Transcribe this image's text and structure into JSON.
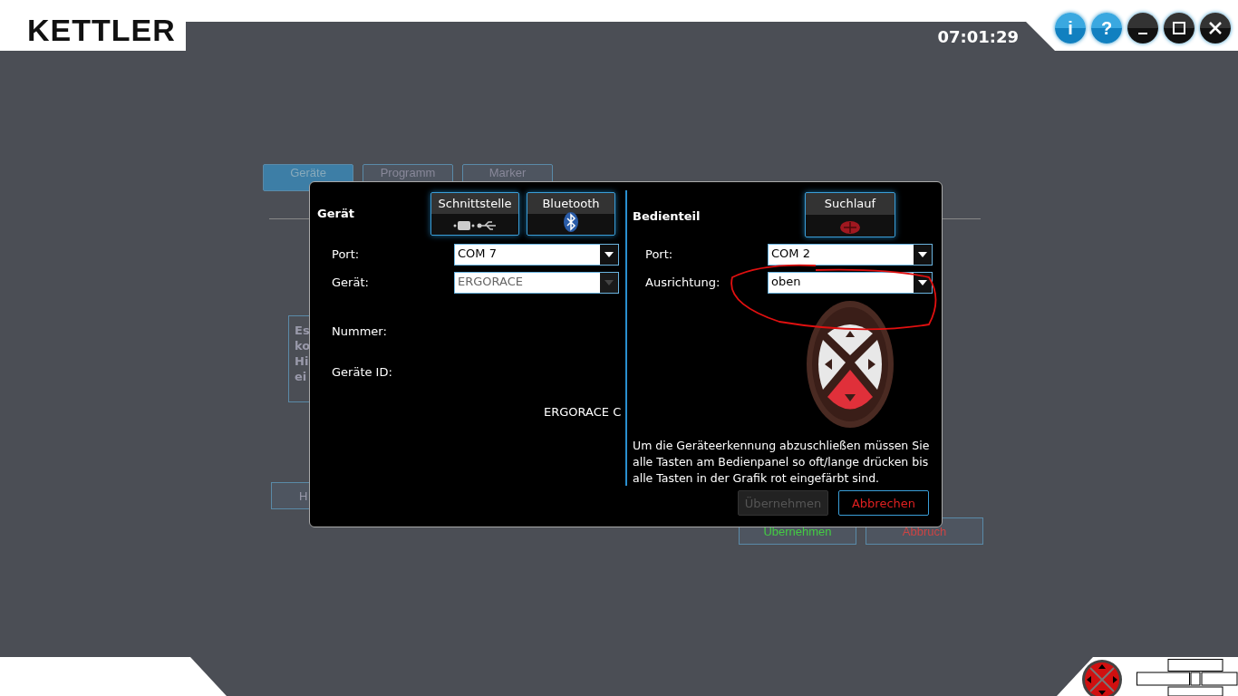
{
  "header": {
    "logo": "KETTLER",
    "clock": "07:01:29",
    "buttons": [
      {
        "kind": "info",
        "label": "i"
      },
      {
        "kind": "help",
        "label": "?"
      },
      {
        "kind": "minimize"
      },
      {
        "kind": "maximize"
      },
      {
        "kind": "close"
      }
    ]
  },
  "background": {
    "tabs": [
      {
        "label": "Geräte",
        "selected": true
      },
      {
        "label": "Programm",
        "selected": false
      },
      {
        "label": "Marker",
        "selected": false
      }
    ],
    "info_lines": [
      "Es",
      "ko",
      "Hi",
      "ei"
    ],
    "side_button": "H",
    "apply_button": "Übernehmen",
    "cancel_button": "Abbruch"
  },
  "dialog": {
    "left": {
      "title": "Gerät",
      "buttons": [
        {
          "label": "Schnittstelle",
          "kind": "interface"
        },
        {
          "label": "Bluetooth",
          "kind": "bluetooth"
        }
      ],
      "fields": [
        {
          "label": "Port:",
          "value": "COM 7",
          "disabled": false
        },
        {
          "label": "Gerät:",
          "value": "ERGORACE",
          "disabled": true
        }
      ],
      "info": [
        {
          "label": "Nummer:"
        },
        {
          "label": "Geräte ID:"
        }
      ],
      "device_name": "ERGORACE C"
    },
    "right": {
      "title": "Bedienteil",
      "scan_button": "Suchlauf",
      "fields": [
        {
          "label": "Port:",
          "value": "COM 2",
          "disabled": false
        },
        {
          "label": "Ausrichtung:",
          "value": "oben",
          "disabled": false
        }
      ],
      "remote_keys": [
        {
          "kind": "up",
          "pressed": false
        },
        {
          "kind": "left",
          "pressed": false
        },
        {
          "kind": "right",
          "pressed": false
        },
        {
          "kind": "down",
          "pressed": true
        }
      ],
      "instructions": "Um die Geräteerkennung abzuschließen müssen Sie alle Tasten am Bedienpanel so oft/lange drücken bis alle Tasten in der Grafik rot eingefärbt sind."
    },
    "apply_button": {
      "label": "Übernehmen",
      "disabled": true
    },
    "cancel_button": {
      "label": "Abbrechen",
      "disabled": false
    }
  }
}
